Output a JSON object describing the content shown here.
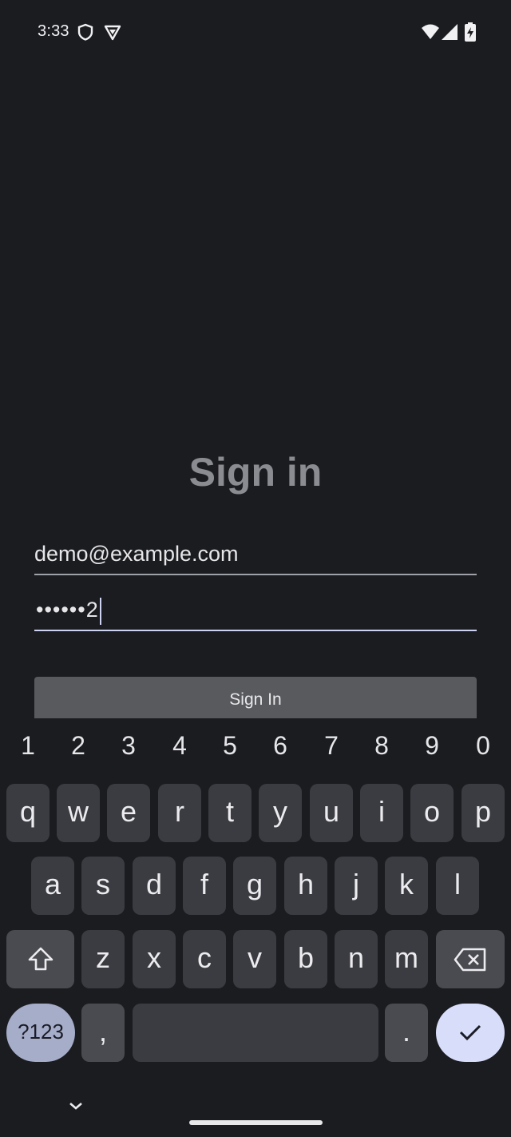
{
  "status_bar": {
    "time": "3:33",
    "left_icons": [
      "shield-icon",
      "vpn-icon"
    ],
    "right_icons": [
      "wifi-icon",
      "signal-icon",
      "battery-charging-icon"
    ]
  },
  "form": {
    "title": "Sign in",
    "email_value": "demo@example.com",
    "password_masked": "••••••",
    "password_last_char": "2",
    "sign_in_button": "Sign In"
  },
  "keyboard": {
    "number_row": [
      "1",
      "2",
      "3",
      "4",
      "5",
      "6",
      "7",
      "8",
      "9",
      "0"
    ],
    "row1": [
      "q",
      "w",
      "e",
      "r",
      "t",
      "y",
      "u",
      "i",
      "o",
      "p"
    ],
    "row2": [
      "a",
      "s",
      "d",
      "f",
      "g",
      "h",
      "j",
      "k",
      "l"
    ],
    "row3": [
      "z",
      "x",
      "c",
      "v",
      "b",
      "n",
      "m"
    ],
    "symbols_key": "?123",
    "comma_key": ",",
    "period_key": ".",
    "icons": [
      "shift-icon",
      "backspace-icon",
      "checkmark-icon",
      "chevron-down-icon"
    ]
  }
}
